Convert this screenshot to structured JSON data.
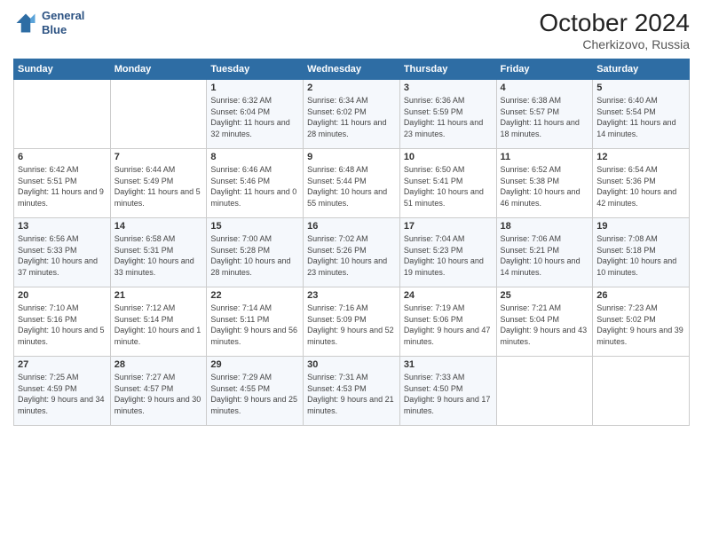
{
  "header": {
    "logo_line1": "General",
    "logo_line2": "Blue",
    "month": "October 2024",
    "location": "Cherkizovo, Russia"
  },
  "weekdays": [
    "Sunday",
    "Monday",
    "Tuesday",
    "Wednesday",
    "Thursday",
    "Friday",
    "Saturday"
  ],
  "weeks": [
    [
      {
        "day": "",
        "sunrise": "",
        "sunset": "",
        "daylight": ""
      },
      {
        "day": "",
        "sunrise": "",
        "sunset": "",
        "daylight": ""
      },
      {
        "day": "1",
        "sunrise": "Sunrise: 6:32 AM",
        "sunset": "Sunset: 6:04 PM",
        "daylight": "Daylight: 11 hours and 32 minutes."
      },
      {
        "day": "2",
        "sunrise": "Sunrise: 6:34 AM",
        "sunset": "Sunset: 6:02 PM",
        "daylight": "Daylight: 11 hours and 28 minutes."
      },
      {
        "day": "3",
        "sunrise": "Sunrise: 6:36 AM",
        "sunset": "Sunset: 5:59 PM",
        "daylight": "Daylight: 11 hours and 23 minutes."
      },
      {
        "day": "4",
        "sunrise": "Sunrise: 6:38 AM",
        "sunset": "Sunset: 5:57 PM",
        "daylight": "Daylight: 11 hours and 18 minutes."
      },
      {
        "day": "5",
        "sunrise": "Sunrise: 6:40 AM",
        "sunset": "Sunset: 5:54 PM",
        "daylight": "Daylight: 11 hours and 14 minutes."
      }
    ],
    [
      {
        "day": "6",
        "sunrise": "Sunrise: 6:42 AM",
        "sunset": "Sunset: 5:51 PM",
        "daylight": "Daylight: 11 hours and 9 minutes."
      },
      {
        "day": "7",
        "sunrise": "Sunrise: 6:44 AM",
        "sunset": "Sunset: 5:49 PM",
        "daylight": "Daylight: 11 hours and 5 minutes."
      },
      {
        "day": "8",
        "sunrise": "Sunrise: 6:46 AM",
        "sunset": "Sunset: 5:46 PM",
        "daylight": "Daylight: 11 hours and 0 minutes."
      },
      {
        "day": "9",
        "sunrise": "Sunrise: 6:48 AM",
        "sunset": "Sunset: 5:44 PM",
        "daylight": "Daylight: 10 hours and 55 minutes."
      },
      {
        "day": "10",
        "sunrise": "Sunrise: 6:50 AM",
        "sunset": "Sunset: 5:41 PM",
        "daylight": "Daylight: 10 hours and 51 minutes."
      },
      {
        "day": "11",
        "sunrise": "Sunrise: 6:52 AM",
        "sunset": "Sunset: 5:38 PM",
        "daylight": "Daylight: 10 hours and 46 minutes."
      },
      {
        "day": "12",
        "sunrise": "Sunrise: 6:54 AM",
        "sunset": "Sunset: 5:36 PM",
        "daylight": "Daylight: 10 hours and 42 minutes."
      }
    ],
    [
      {
        "day": "13",
        "sunrise": "Sunrise: 6:56 AM",
        "sunset": "Sunset: 5:33 PM",
        "daylight": "Daylight: 10 hours and 37 minutes."
      },
      {
        "day": "14",
        "sunrise": "Sunrise: 6:58 AM",
        "sunset": "Sunset: 5:31 PM",
        "daylight": "Daylight: 10 hours and 33 minutes."
      },
      {
        "day": "15",
        "sunrise": "Sunrise: 7:00 AM",
        "sunset": "Sunset: 5:28 PM",
        "daylight": "Daylight: 10 hours and 28 minutes."
      },
      {
        "day": "16",
        "sunrise": "Sunrise: 7:02 AM",
        "sunset": "Sunset: 5:26 PM",
        "daylight": "Daylight: 10 hours and 23 minutes."
      },
      {
        "day": "17",
        "sunrise": "Sunrise: 7:04 AM",
        "sunset": "Sunset: 5:23 PM",
        "daylight": "Daylight: 10 hours and 19 minutes."
      },
      {
        "day": "18",
        "sunrise": "Sunrise: 7:06 AM",
        "sunset": "Sunset: 5:21 PM",
        "daylight": "Daylight: 10 hours and 14 minutes."
      },
      {
        "day": "19",
        "sunrise": "Sunrise: 7:08 AM",
        "sunset": "Sunset: 5:18 PM",
        "daylight": "Daylight: 10 hours and 10 minutes."
      }
    ],
    [
      {
        "day": "20",
        "sunrise": "Sunrise: 7:10 AM",
        "sunset": "Sunset: 5:16 PM",
        "daylight": "Daylight: 10 hours and 5 minutes."
      },
      {
        "day": "21",
        "sunrise": "Sunrise: 7:12 AM",
        "sunset": "Sunset: 5:14 PM",
        "daylight": "Daylight: 10 hours and 1 minute."
      },
      {
        "day": "22",
        "sunrise": "Sunrise: 7:14 AM",
        "sunset": "Sunset: 5:11 PM",
        "daylight": "Daylight: 9 hours and 56 minutes."
      },
      {
        "day": "23",
        "sunrise": "Sunrise: 7:16 AM",
        "sunset": "Sunset: 5:09 PM",
        "daylight": "Daylight: 9 hours and 52 minutes."
      },
      {
        "day": "24",
        "sunrise": "Sunrise: 7:19 AM",
        "sunset": "Sunset: 5:06 PM",
        "daylight": "Daylight: 9 hours and 47 minutes."
      },
      {
        "day": "25",
        "sunrise": "Sunrise: 7:21 AM",
        "sunset": "Sunset: 5:04 PM",
        "daylight": "Daylight: 9 hours and 43 minutes."
      },
      {
        "day": "26",
        "sunrise": "Sunrise: 7:23 AM",
        "sunset": "Sunset: 5:02 PM",
        "daylight": "Daylight: 9 hours and 39 minutes."
      }
    ],
    [
      {
        "day": "27",
        "sunrise": "Sunrise: 7:25 AM",
        "sunset": "Sunset: 4:59 PM",
        "daylight": "Daylight: 9 hours and 34 minutes."
      },
      {
        "day": "28",
        "sunrise": "Sunrise: 7:27 AM",
        "sunset": "Sunset: 4:57 PM",
        "daylight": "Daylight: 9 hours and 30 minutes."
      },
      {
        "day": "29",
        "sunrise": "Sunrise: 7:29 AM",
        "sunset": "Sunset: 4:55 PM",
        "daylight": "Daylight: 9 hours and 25 minutes."
      },
      {
        "day": "30",
        "sunrise": "Sunrise: 7:31 AM",
        "sunset": "Sunset: 4:53 PM",
        "daylight": "Daylight: 9 hours and 21 minutes."
      },
      {
        "day": "31",
        "sunrise": "Sunrise: 7:33 AM",
        "sunset": "Sunset: 4:50 PM",
        "daylight": "Daylight: 9 hours and 17 minutes."
      },
      {
        "day": "",
        "sunrise": "",
        "sunset": "",
        "daylight": ""
      },
      {
        "day": "",
        "sunrise": "",
        "sunset": "",
        "daylight": ""
      }
    ]
  ]
}
